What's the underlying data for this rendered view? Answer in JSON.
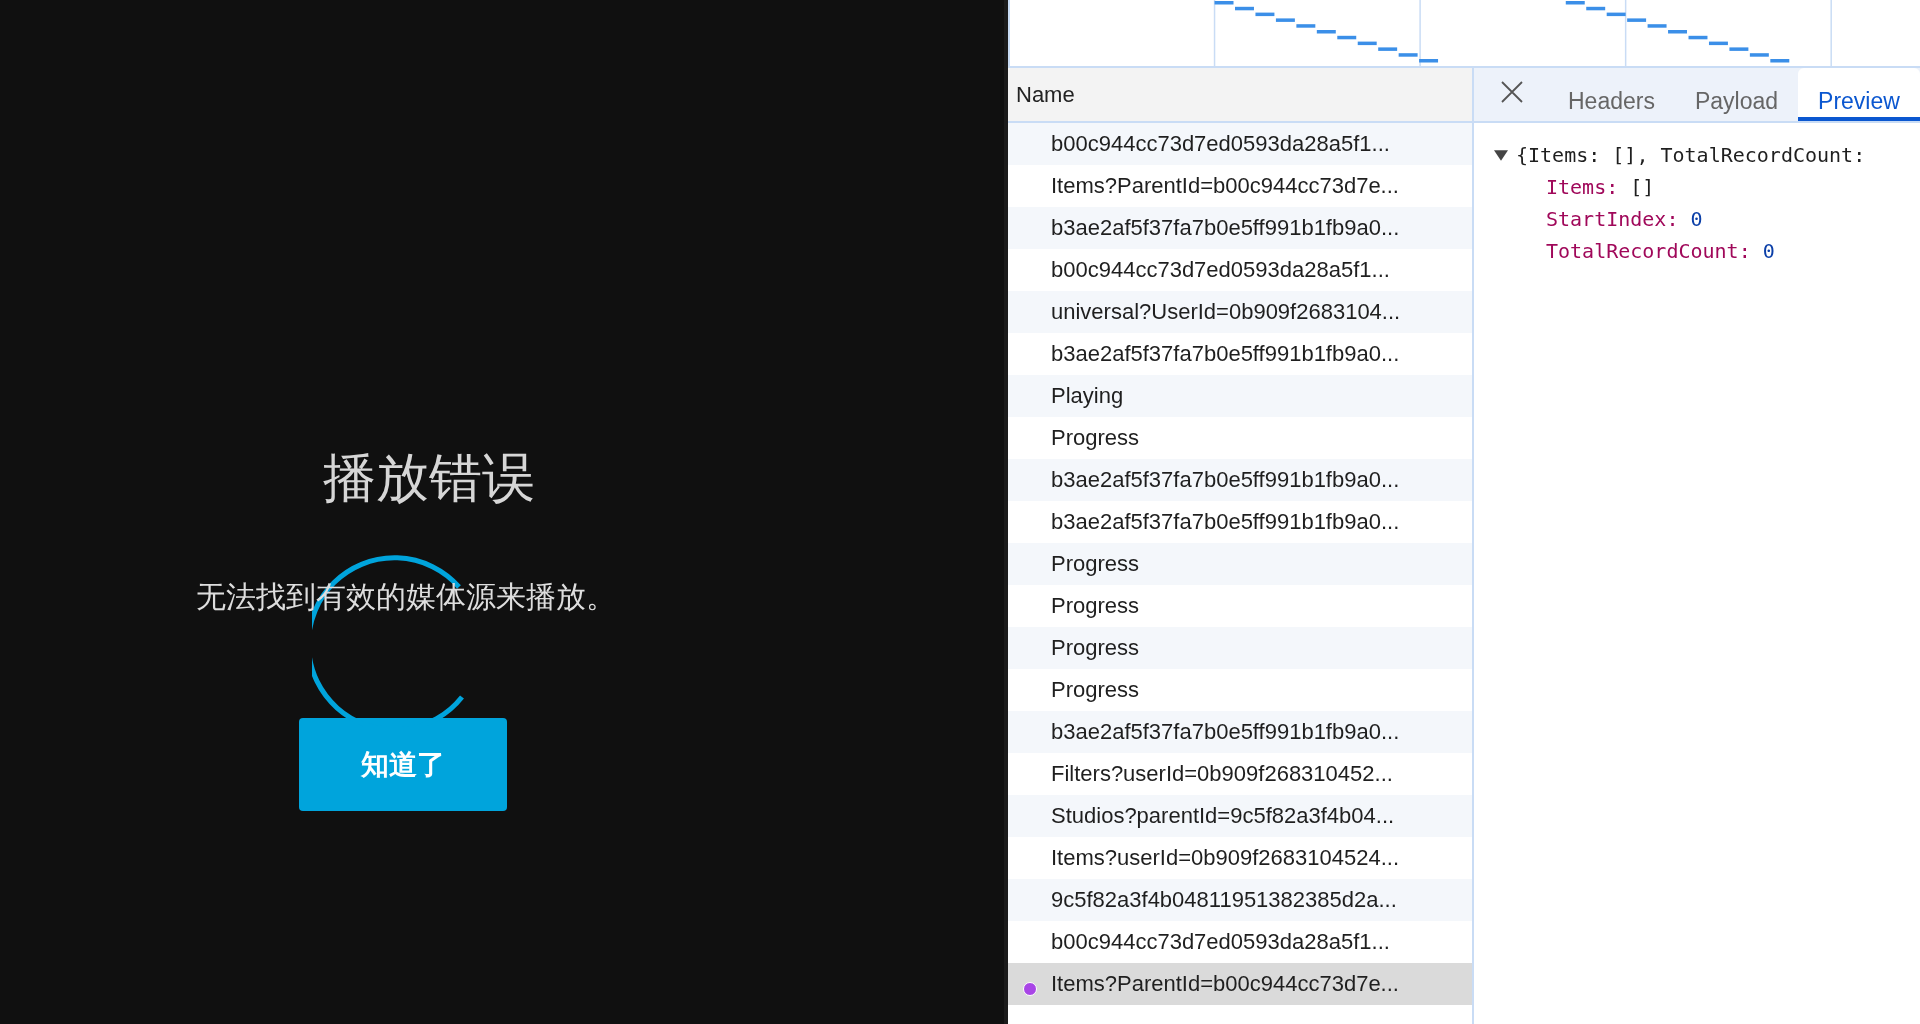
{
  "player_error": {
    "title": "播放错误",
    "message": "无法找到有效的媒体源来播放。",
    "button": "知道了",
    "loading": true
  },
  "network": {
    "name_header": "Name",
    "requests": [
      {
        "name": "b00c944cc73d7ed0593da28a5f1...",
        "selected": false
      },
      {
        "name": "Items?ParentId=b00c944cc73d7e...",
        "selected": false
      },
      {
        "name": "b3ae2af5f37fa7b0e5ff991b1fb9a0...",
        "selected": false
      },
      {
        "name": "b00c944cc73d7ed0593da28a5f1...",
        "selected": false
      },
      {
        "name": "universal?UserId=0b909f2683104...",
        "selected": false
      },
      {
        "name": "b3ae2af5f37fa7b0e5ff991b1fb9a0...",
        "selected": false
      },
      {
        "name": "Playing",
        "selected": false
      },
      {
        "name": "Progress",
        "selected": false
      },
      {
        "name": "b3ae2af5f37fa7b0e5ff991b1fb9a0...",
        "selected": false
      },
      {
        "name": "b3ae2af5f37fa7b0e5ff991b1fb9a0...",
        "selected": false
      },
      {
        "name": "Progress",
        "selected": false
      },
      {
        "name": "Progress",
        "selected": false
      },
      {
        "name": "Progress",
        "selected": false
      },
      {
        "name": "Progress",
        "selected": false
      },
      {
        "name": "b3ae2af5f37fa7b0e5ff991b1fb9a0...",
        "selected": false
      },
      {
        "name": "Filters?userId=0b909f268310452...",
        "selected": false
      },
      {
        "name": "Studios?parentId=9c5f82a3f4b04...",
        "selected": false
      },
      {
        "name": "Items?userId=0b909f2683104524...",
        "selected": false
      },
      {
        "name": "9c5f82a3f4b04811951382385d2a...",
        "selected": false
      },
      {
        "name": "b00c944cc73d7ed0593da28a5f1...",
        "selected": false
      },
      {
        "name": "Items?ParentId=b00c944cc73d7e...",
        "selected": true
      }
    ],
    "tabs": [
      {
        "label": "Headers",
        "selected": false
      },
      {
        "label": "Payload",
        "selected": false
      },
      {
        "label": "Preview",
        "selected": true
      }
    ],
    "preview": {
      "summary": "{Items: [], TotalRecordCount:",
      "expanded": true,
      "fields": [
        {
          "key": "Items:",
          "value": "[]",
          "kind": "array"
        },
        {
          "key": "StartIndex:",
          "value": "0",
          "kind": "number"
        },
        {
          "key": "TotalRecordCount:",
          "value": "0",
          "kind": "number"
        }
      ]
    }
  }
}
